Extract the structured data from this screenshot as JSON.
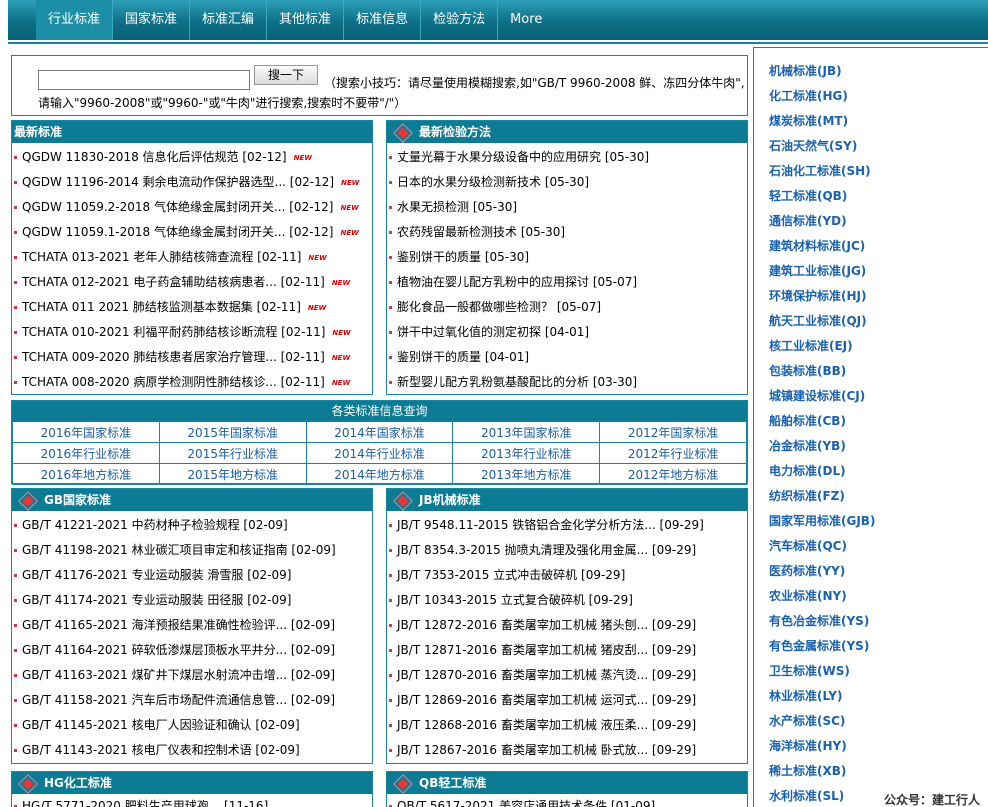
{
  "nav": {
    "items": [
      "行业标准",
      "国家标准",
      "标准汇编",
      "其他标准",
      "标准信息",
      "检验方法",
      "More"
    ]
  },
  "search": {
    "input_value": "",
    "button_label": "搜一下",
    "tip_line1": "（搜索小技巧：请尽量使用模糊搜索,如\"GB/T 9960-2008 鲜、冻四分体牛肉\",",
    "tip_line2": "请输入\"9960-2008\"或\"9960-\"或\"牛肉\"进行搜索,搜索时不要带\"/\"）"
  },
  "latest_standards": {
    "title": "最新标准",
    "new_badge": "NEW",
    "items": [
      {
        "text": "QGDW 11830-2018 信息化后评估规范",
        "date": "[02-12]"
      },
      {
        "text": "QGDW 11196-2014 剩余电流动作保护器选型...",
        "date": "[02-12]"
      },
      {
        "text": "QGDW 11059.2-2018 气体绝缘金属封闭开关...",
        "date": "[02-12]"
      },
      {
        "text": "QGDW 11059.1-2018 气体绝缘金属封闭开关...",
        "date": "[02-12]"
      },
      {
        "text": "TCHATA 013-2021 老年人肺结核筛查流程",
        "date": "[02-11]"
      },
      {
        "text": "TCHATA 012-2021 电子药盒辅助结核病患者...",
        "date": "[02-11]"
      },
      {
        "text": "TCHATA 011 2021 肺结核监测基本数据集",
        "date": "[02-11]"
      },
      {
        "text": "TCHATA 010-2021 利福平耐药肺结核诊断流程",
        "date": "[02-11]"
      },
      {
        "text": "TCHATA 009-2020 肺结核患者居家治疗管理...",
        "date": "[02-11]"
      },
      {
        "text": "TCHATA 008-2020 病原学检测阴性肺结核诊...",
        "date": "[02-11]"
      }
    ]
  },
  "latest_methods": {
    "title": "最新检验方法",
    "items": [
      {
        "text": "丈量光幕于水果分级设备中的应用研究",
        "date": "[05-30]"
      },
      {
        "text": "日本的水果分级检测新技术",
        "date": "[05-30]"
      },
      {
        "text": "水果无损检测",
        "date": "[05-30]"
      },
      {
        "text": "农药残留最新检测技术",
        "date": "[05-30]"
      },
      {
        "text": "鉴别饼干的质量",
        "date": "[05-30]"
      },
      {
        "text": "植物油在婴儿配方乳粉中的应用探讨",
        "date": "[05-07]"
      },
      {
        "text": "膨化食品一般都做哪些检测？",
        "date": "[05-07]"
      },
      {
        "text": "饼干中过氧化值的测定初探",
        "date": "[04-01]"
      },
      {
        "text": "鉴别饼干的质量",
        "date": "[04-01]"
      },
      {
        "text": "新型婴儿配方乳粉氨基酸配比的分析",
        "date": "[03-30]"
      }
    ]
  },
  "query": {
    "title": "各类标准信息查询",
    "rows": [
      [
        "2016年国家标准",
        "2015年国家标准",
        "2014年国家标准",
        "2013年国家标准",
        "2012年国家标准"
      ],
      [
        "2016年行业标准",
        "2015年行业标准",
        "2014年行业标准",
        "2013年行业标准",
        "2012年行业标准"
      ],
      [
        "2016年地方标准",
        "2015年地方标准",
        "2014年地方标准",
        "2013年地方标准",
        "2012年地方标准"
      ]
    ]
  },
  "gb": {
    "title": "GB国家标准",
    "items": [
      {
        "text": "GB/T 41221-2021 中药材种子检验规程",
        "date": "[02-09]"
      },
      {
        "text": "GB/T 41198-2021 林业碳汇项目审定和核证指南",
        "date": "[02-09]"
      },
      {
        "text": "GB/T 41176-2021 专业运动服装 滑雪服",
        "date": "[02-09]"
      },
      {
        "text": "GB/T 41174-2021 专业运动服装 田径服",
        "date": "[02-09]"
      },
      {
        "text": "GB/T 41165-2021 海洋预报结果准确性检验评...",
        "date": "[02-09]"
      },
      {
        "text": "GB/T 41164-2021 碎软低渗煤层顶板水平井分...",
        "date": "[02-09]"
      },
      {
        "text": "GB/T 41163-2021 煤矿井下煤层水射流冲击增...",
        "date": "[02-09]"
      },
      {
        "text": "GB/T 41158-2021 汽车后市场配件流通信息管...",
        "date": "[02-09]"
      },
      {
        "text": "GB/T 41145-2021 核电厂人因验证和确认",
        "date": "[02-09]"
      },
      {
        "text": "GB/T 41143-2021 核电厂仪表和控制术语",
        "date": "[02-09]"
      }
    ]
  },
  "jb": {
    "title": "JB机械标准",
    "items": [
      {
        "text": "JB/T 9548.11-2015 铁铬铝合金化学分析方法...",
        "date": "[09-29]"
      },
      {
        "text": "JB/T 8354.3-2015 抛喷丸清理及强化用金属...",
        "date": "[09-29]"
      },
      {
        "text": "JB/T 7353-2015 立式冲击破碎机",
        "date": "[09-29]"
      },
      {
        "text": "JB/T 10343-2015 立式复合破碎机",
        "date": "[09-29]"
      },
      {
        "text": "JB/T 12872-2016 畜类屠宰加工机械 猪头刨...",
        "date": "[09-29]"
      },
      {
        "text": "JB/T 12871-2016 畜类屠宰加工机械 猪皮刮...",
        "date": "[09-29]"
      },
      {
        "text": "JB/T 12870-2016 畜类屠宰加工机械 蒸汽烫...",
        "date": "[09-29]"
      },
      {
        "text": "JB/T 12869-2016 畜类屠宰加工机械 运河式...",
        "date": "[09-29]"
      },
      {
        "text": "JB/T 12868-2016 畜类屠宰加工机械 液压柔...",
        "date": "[09-29]"
      },
      {
        "text": "JB/T 12867-2016 畜类屠宰加工机械 卧式放...",
        "date": "[09-29]"
      }
    ]
  },
  "hg": {
    "title": "HG化工标准",
    "items": [
      {
        "text": "HG/T 5771-2020 肥料生产用球孢...",
        "date": "[11-16]"
      }
    ]
  },
  "qb": {
    "title": "QB轻工标准",
    "items": [
      {
        "text": "QB/T 5617-2021 美容店通用技术条件",
        "date": "[01-09]"
      }
    ]
  },
  "sidebar": {
    "items": [
      "机械标准(JB)",
      "化工标准(HG)",
      "煤炭标准(MT)",
      "石油天然气(SY)",
      "石油化工标准(SH)",
      "轻工标准(QB)",
      "通信标准(YD)",
      "建筑材料标准(JC)",
      "建筑工业标准(JG)",
      "环境保护标准(HJ)",
      "航天工业标准(QJ)",
      "核工业标准(EJ)",
      "包装标准(BB)",
      "城镇建设标准(CJ)",
      "船舶标准(CB)",
      "冶金标准(YB)",
      "电力标准(DL)",
      "纺织标准(FZ)",
      "国家军用标准(GJB)",
      "汽车标准(QC)",
      "医药标准(YY)",
      "农业标准(NY)",
      "有色冶金标准(YS)",
      "有色金属标准(YS)",
      "卫生标准(WS)",
      "林业标准(LY)",
      "水产标准(SC)",
      "海洋标准(HY)",
      "稀土标准(XB)",
      "水利标准(SL)"
    ]
  },
  "watermark": "公众号：建工行人",
  "colors": {
    "nav_bg": "#0d6f86",
    "panel_head": "#0e7b94",
    "border": "#1687a0",
    "sidebar_link": "#1a62b0",
    "new_badge": "#dd0000"
  }
}
